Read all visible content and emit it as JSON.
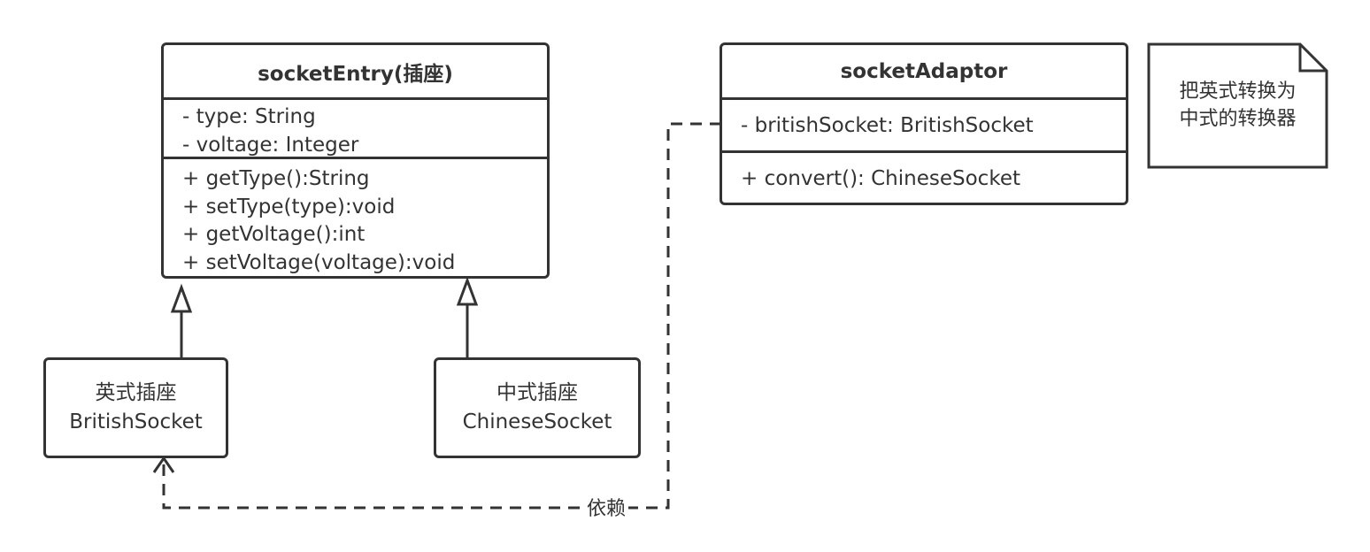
{
  "socket_entry": {
    "title": "socketEntry(插座)",
    "attributes": [
      "- type: String",
      "- voltage: Integer"
    ],
    "methods": [
      "+ getType():String",
      "+ setType(type):void",
      "+ getVoltage():int",
      "+ setVoltage(voltage):void"
    ]
  },
  "socket_adaptor": {
    "title": "socketAdaptor",
    "attributes": [
      "- britishSocket: BritishSocket"
    ],
    "methods": [
      "+ convert(): ChineseSocket"
    ]
  },
  "british_socket": {
    "line1": "英式插座",
    "line2": "BritishSocket"
  },
  "chinese_socket": {
    "line1": "中式插座",
    "line2": "ChineseSocket"
  },
  "note": {
    "line1": "把英式转换为",
    "line2": "中式的转换器"
  },
  "dependency_label": "依赖",
  "colors": {
    "stroke": "#333333",
    "text": "#333333",
    "background": "#ffffff"
  }
}
